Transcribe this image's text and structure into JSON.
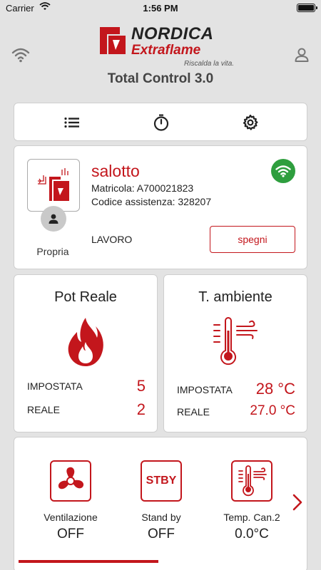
{
  "status_bar": {
    "carrier": "Carrier",
    "time": "1:56 PM"
  },
  "header": {
    "brand_line1": "NORDICA",
    "brand_line2": "Extraflame",
    "tagline": "Riscalda la vita.",
    "app_title": "Total Control 3.0"
  },
  "toolbar": {
    "icons": [
      "list-icon",
      "timer-icon",
      "settings-icon"
    ]
  },
  "stove": {
    "name": "salotto",
    "serial": "Matricola: A700021823",
    "assistance_code": "Codice assistenza: 328207",
    "owner_label": "Propria",
    "state": "LAVORO",
    "off_button": "spegni"
  },
  "power": {
    "title": "Pot Reale",
    "set_label": "IMPOSTATA",
    "set_value": "5",
    "real_label": "REALE",
    "real_value": "2"
  },
  "ambient": {
    "title": "T. ambiente",
    "set_label": "IMPOSTATA",
    "set_value": "28 °C",
    "real_label": "REALE",
    "real_value": "27.0 °C"
  },
  "functions": [
    {
      "label": "Ventilazione",
      "value": "OFF",
      "icon": "fan-icon"
    },
    {
      "label": "Stand by",
      "value": "OFF",
      "icon_text": "STBY"
    },
    {
      "label": "Temp. Can.2",
      "value": "0.0°C",
      "icon": "thermometer-icon"
    }
  ],
  "colors": {
    "accent": "#c3161c",
    "online": "#2e9e3e",
    "background": "#e3e3e3"
  }
}
